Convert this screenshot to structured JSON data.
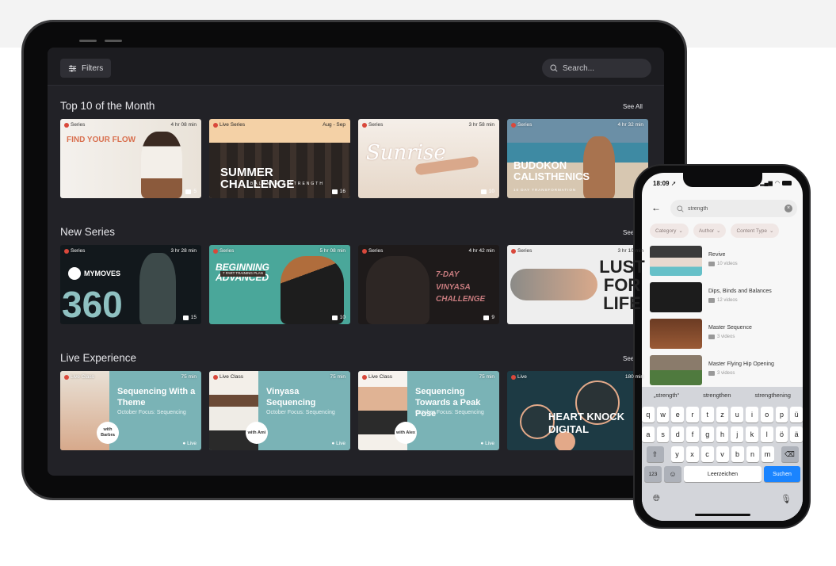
{
  "tablet": {
    "filters_label": "Filters",
    "search_placeholder": "Search...",
    "sections": [
      {
        "title": "Top 10 of the Month",
        "see_all": "See All",
        "cards": [
          {
            "badge": "Series",
            "duration": "4 hr 08 min",
            "title": "FIND YOUR FLOW",
            "count": "5"
          },
          {
            "badge": "Live Series",
            "duration": "Aug - Sep",
            "title": "SUMMER CHALLENGE",
            "subtitle": "BALANCE & STRENGTH",
            "count": "16"
          },
          {
            "badge": "Series",
            "duration": "3 hr 58 min",
            "title": "Sunrise",
            "count": "10"
          },
          {
            "badge": "Series",
            "duration": "4 hr 32 min",
            "title": "BUDOKON CALISTHENICS",
            "subtitle": "10 DAY TRANSFORMATION",
            "count": ""
          }
        ]
      },
      {
        "title": "New Series",
        "see_all": "See All",
        "cards": [
          {
            "badge": "Series",
            "duration": "3 hr 28 min",
            "title": "360",
            "brand": "MYMOVES",
            "count": "15"
          },
          {
            "badge": "Series",
            "duration": "5 hr 08 min",
            "title": "BEGINNING ADVANCED",
            "subtitle": "7 PART TRAINING PLAN",
            "count": "10"
          },
          {
            "badge": "Series",
            "duration": "4 hr 42 min",
            "title": "7-DAY VINYASA CHALLENGE",
            "count": "9"
          },
          {
            "badge": "Series",
            "duration": "3 hr 10 min",
            "title": "LUST FOR LIFE",
            "count": ""
          }
        ]
      },
      {
        "title": "Live Experience",
        "see_all": "See All",
        "cards": [
          {
            "badge": "Live Class",
            "duration": "75 min",
            "title": "Sequencing With a Theme",
            "subtitle": "October Focus: Sequencing",
            "with": "with Barbra",
            "status": "Live"
          },
          {
            "badge": "Live Class",
            "duration": "75 min",
            "title": "Vinyasa Sequencing",
            "subtitle": "October Focus: Sequencing",
            "with": "with Ami",
            "status": "Live"
          },
          {
            "badge": "Live Class",
            "duration": "75 min",
            "title": "Sequencing Towards a Peak Pose",
            "subtitle": "October Focus: Sequencing",
            "with": "with Alex",
            "status": "Live"
          },
          {
            "badge": "Live",
            "duration": "180 min",
            "title": "HEART KNOCK DIGITAL",
            "status": "Live"
          }
        ]
      }
    ]
  },
  "phone": {
    "time": "18:09",
    "search_value": "strength",
    "chips": [
      "Category",
      "Author",
      "Content Type"
    ],
    "results": [
      {
        "title": "Revive",
        "count": "10 videos"
      },
      {
        "title": "Dips, Binds and Balances",
        "count": "12 videos"
      },
      {
        "title": "Master Sequence",
        "count": "3 videos"
      },
      {
        "title": "Master Flying Hip Opening",
        "count": "3 videos"
      }
    ],
    "keyboard": {
      "suggestions": [
        "„strength“",
        "strengthen",
        "strengthening"
      ],
      "row1": [
        "q",
        "w",
        "e",
        "r",
        "t",
        "z",
        "u",
        "i",
        "o",
        "p",
        "ü"
      ],
      "row2": [
        "a",
        "s",
        "d",
        "f",
        "g",
        "h",
        "j",
        "k",
        "l",
        "ö",
        "ä"
      ],
      "row3": [
        "y",
        "x",
        "c",
        "v",
        "b",
        "n",
        "m"
      ],
      "numbers_key": "123",
      "space_key": "Leerzeichen",
      "go_key": "Suchen"
    }
  }
}
